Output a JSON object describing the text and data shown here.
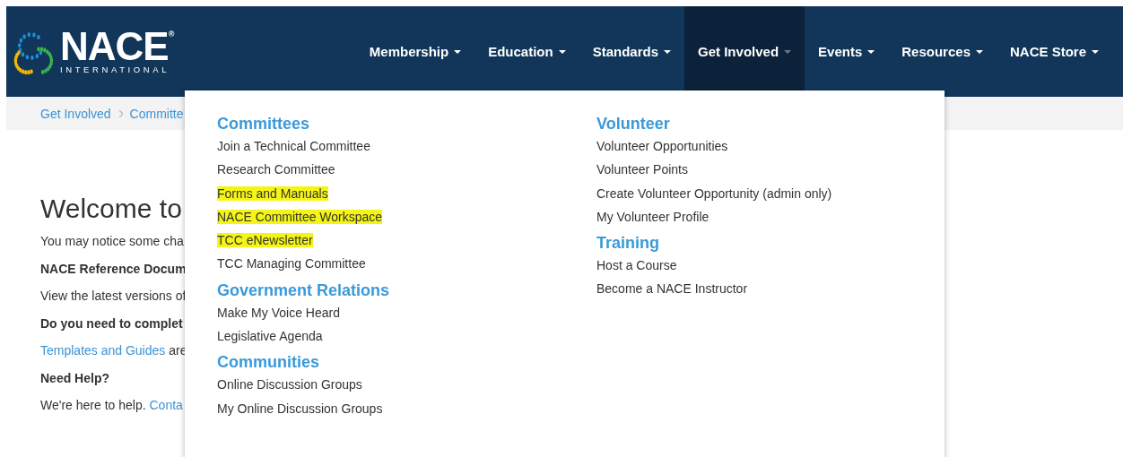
{
  "logo": {
    "name": "NACE",
    "registered": "®",
    "subtitle": "INTERNATIONAL"
  },
  "nav": [
    {
      "label": "Membership",
      "selected": false
    },
    {
      "label": "Education",
      "selected": false
    },
    {
      "label": "Standards",
      "selected": false
    },
    {
      "label": "Get Involved",
      "selected": true
    },
    {
      "label": "Events",
      "selected": false
    },
    {
      "label": "Resources",
      "selected": false
    },
    {
      "label": "NACE Store",
      "selected": false
    }
  ],
  "breadcrumb": [
    "Get Involved",
    "Committe"
  ],
  "content": {
    "title": "Welcome to",
    "paragraphs": [
      {
        "kind": "text",
        "parts": [
          {
            "text": "You may notice some cha",
            "link": false
          }
        ]
      },
      {
        "kind": "bold",
        "parts": [
          {
            "text": "NACE Reference Docum",
            "link": false
          }
        ]
      },
      {
        "kind": "text",
        "parts": [
          {
            "text": "View the latest versions of",
            "link": false
          }
        ]
      },
      {
        "kind": "bold",
        "parts": [
          {
            "text": "Do you need to complet",
            "link": false
          }
        ]
      },
      {
        "kind": "text",
        "parts": [
          {
            "text": "Templates and Guides",
            "link": true
          },
          {
            "text": "are",
            "link": false
          }
        ]
      },
      {
        "kind": "bold",
        "parts": [
          {
            "text": "Need Help?",
            "link": false
          }
        ]
      },
      {
        "kind": "text",
        "parts": [
          {
            "text": "We're here to help.",
            "link": false
          },
          {
            "text": "Conta",
            "link": true
          }
        ]
      }
    ]
  },
  "menu": {
    "columns": [
      [
        {
          "heading": "Committees",
          "items": [
            {
              "label": "Join a Technical Committee",
              "highlighted": false
            },
            {
              "label": "Research Committee",
              "highlighted": false
            },
            {
              "label": "Forms and Manuals",
              "highlighted": true
            },
            {
              "label": "NACE Committee Workspace",
              "highlighted": true
            },
            {
              "label": "TCC eNewsletter",
              "highlighted": true
            },
            {
              "label": "TCC Managing Committee",
              "highlighted": false
            }
          ]
        },
        {
          "heading": "Government Relations",
          "items": [
            {
              "label": "Make My Voice Heard",
              "highlighted": false
            },
            {
              "label": "Legislative Agenda",
              "highlighted": false
            }
          ]
        },
        {
          "heading": "Communities",
          "items": [
            {
              "label": "Online Discussion Groups",
              "highlighted": false
            },
            {
              "label": "My Online Discussion Groups",
              "highlighted": false
            }
          ]
        }
      ],
      [
        {
          "heading": "Volunteer",
          "items": [
            {
              "label": "Volunteer Opportunities",
              "highlighted": false
            },
            {
              "label": "Volunteer Points",
              "highlighted": false
            },
            {
              "label": "Create Volunteer Opportunity (admin only)",
              "highlighted": false
            },
            {
              "label": "My Volunteer Profile",
              "highlighted": false
            }
          ]
        },
        {
          "heading": "Training",
          "items": [
            {
              "label": "Host a Course",
              "highlighted": false
            },
            {
              "label": "Become a NACE Instructor",
              "highlighted": false
            }
          ]
        }
      ]
    ]
  }
}
